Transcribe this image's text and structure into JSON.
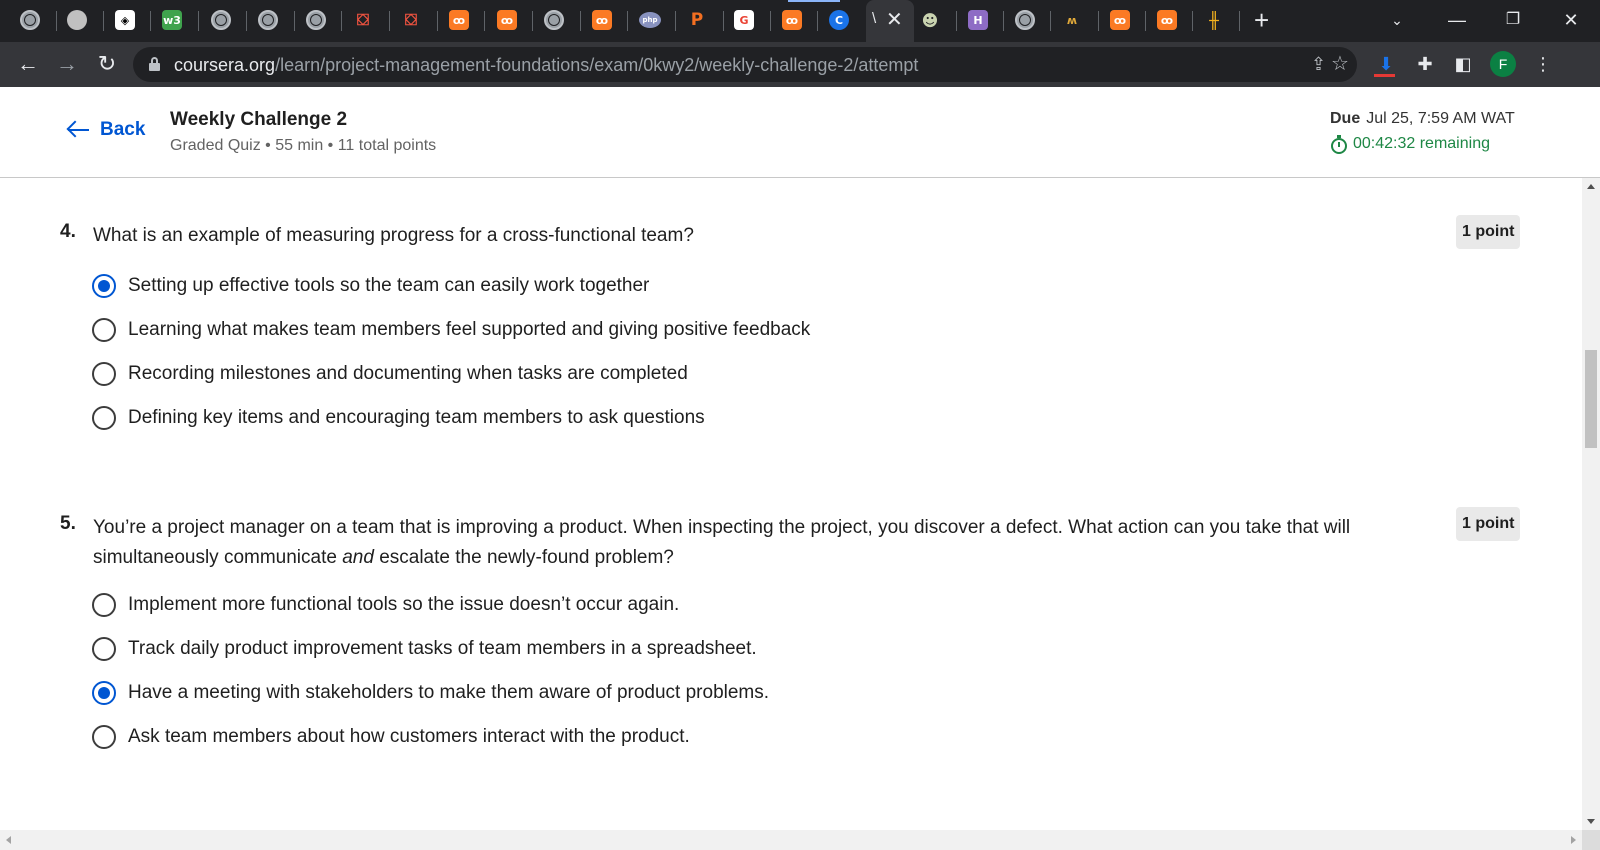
{
  "browser": {
    "tabs": [
      {
        "icon": "globe-icon",
        "text": ""
      },
      {
        "icon": "moon-icon",
        "text": ""
      },
      {
        "icon": "codepen-icon",
        "text": "◈"
      },
      {
        "icon": "w3schools-icon",
        "text": "w3"
      },
      {
        "icon": "globe-icon",
        "text": ""
      },
      {
        "icon": "globe-icon",
        "text": ""
      },
      {
        "icon": "globe-icon",
        "text": ""
      },
      {
        "icon": "laravel-icon",
        "text": "⛋"
      },
      {
        "icon": "laravel-icon",
        "text": "⛋"
      },
      {
        "icon": "xampp-icon",
        "text": "ꝏ"
      },
      {
        "icon": "xampp-icon",
        "text": "ꝏ"
      },
      {
        "icon": "globe-icon",
        "text": ""
      },
      {
        "icon": "xampp-icon",
        "text": "ꝏ"
      },
      {
        "icon": "php-icon",
        "text": "php"
      },
      {
        "icon": "p-icon",
        "text": "P"
      },
      {
        "icon": "google-icon",
        "text": "G"
      },
      {
        "icon": "xampp-icon",
        "text": "ꝏ"
      },
      {
        "icon": "coursera-icon",
        "text": "C"
      },
      {
        "icon": "robot-icon",
        "text": "☻"
      },
      {
        "icon": "heroku-icon",
        "text": "H"
      },
      {
        "icon": "globe-icon",
        "text": ""
      },
      {
        "icon": "nodeapp-icon",
        "text": "ʍ"
      },
      {
        "icon": "xampp-icon",
        "text": "ꝏ"
      },
      {
        "icon": "xampp-icon",
        "text": "ꝏ"
      },
      {
        "icon": "chart-icon",
        "text": "╫"
      }
    ],
    "active_tab_label": "\\",
    "url_host": "coursera.org",
    "url_path": "/learn/project-management-foundations/exam/0kwy2/weekly-challenge-2/attempt",
    "profile_initial": "F"
  },
  "header": {
    "back_label": "Back",
    "title": "Weekly Challenge 2",
    "meta": "Graded Quiz • 55 min • 11 total points",
    "due_label": "Due",
    "due_value": "Jul 25, 7:59 AM WAT",
    "timer": "00:42:32 remaining"
  },
  "questions": [
    {
      "number": "4.",
      "text": "What is an example of measuring progress for a cross-functional team?",
      "points": "1 point",
      "options": [
        {
          "label": "Setting up effective tools so the team can easily work together",
          "selected": true
        },
        {
          "label": "Learning what makes team members feel supported and giving positive feedback",
          "selected": false
        },
        {
          "label": "Recording milestones and documenting when tasks are completed",
          "selected": false
        },
        {
          "label": "Defining key items and encouraging team members to ask questions",
          "selected": false
        }
      ]
    },
    {
      "number": "5.",
      "text_before": "You’re a project manager on a team that is improving a product. When inspecting the project, you discover a defect. What action can you take that will simultaneously communicate ",
      "text_emphasis": "and",
      "text_after": " escalate the newly-found problem?",
      "points": "1 point",
      "options": [
        {
          "label": "Implement more functional tools so the issue doesn’t occur again.",
          "selected": false
        },
        {
          "label": "Track daily product improvement tasks of team members in a spreadsheet.",
          "selected": false
        },
        {
          "label": "Have a meeting with stakeholders to make them aware of product problems.",
          "selected": true
        },
        {
          "label": "Ask team members about how customers interact with the product.",
          "selected": false
        }
      ]
    }
  ],
  "colors": {
    "accent": "#0056d2",
    "timer_green": "#1e8745"
  }
}
